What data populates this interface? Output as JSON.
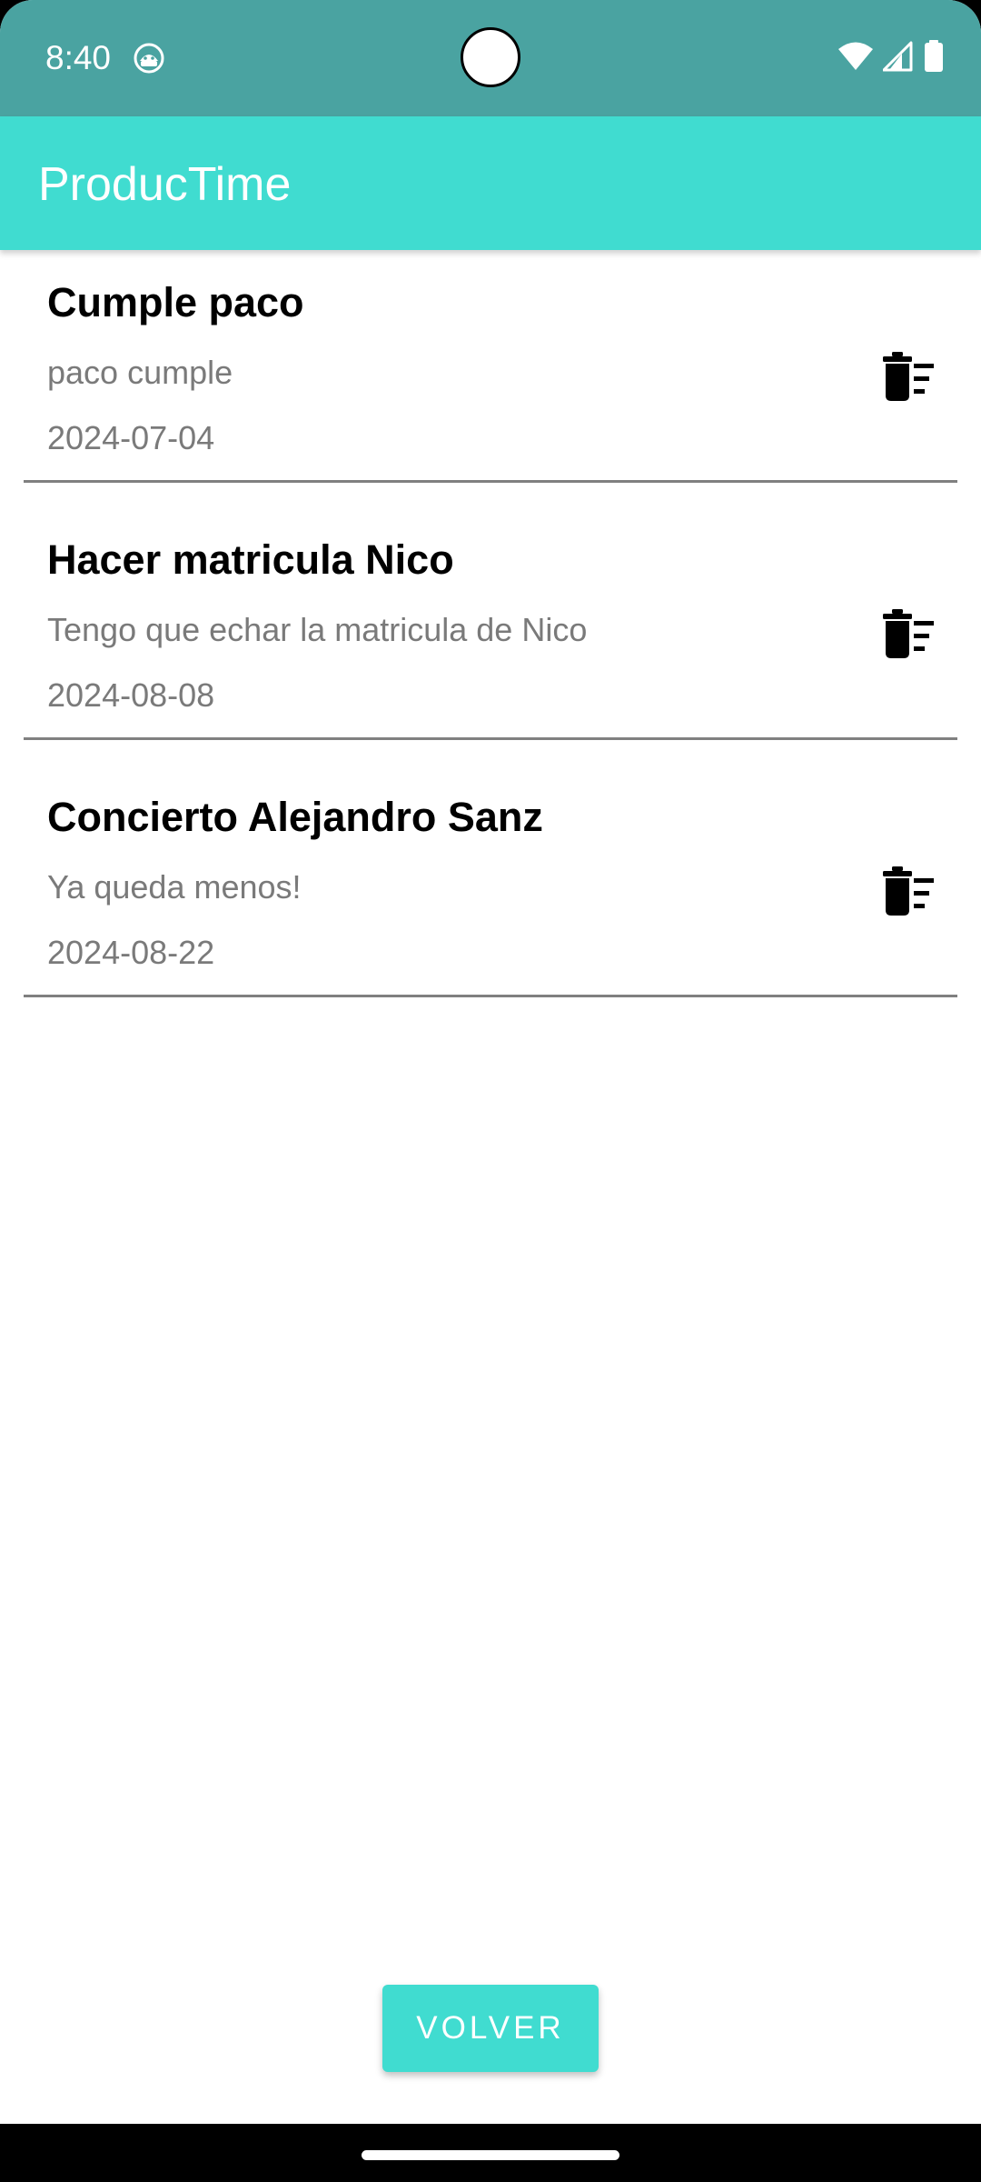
{
  "status_bar": {
    "time": "8:40",
    "app_icon": "android-robot-icon",
    "icons": [
      "wifi-icon",
      "cellular-signal-icon",
      "battery-icon"
    ]
  },
  "app_bar": {
    "title": "ProducTime"
  },
  "tasks": [
    {
      "title": "Cumple paco",
      "description": "paco cumple",
      "date": "2024-07-04",
      "action_icon": "delete-sweep-icon"
    },
    {
      "title": "Hacer matricula Nico",
      "description": "Tengo que echar la matricula de Nico",
      "date": "2024-08-08",
      "action_icon": "delete-sweep-icon"
    },
    {
      "title": "Concierto Alejandro Sanz",
      "description": "Ya queda menos!",
      "date": "2024-08-22",
      "action_icon": "delete-sweep-icon"
    }
  ],
  "footer": {
    "back_button_label": "VOLVER"
  },
  "colors": {
    "status_bar": "#4aa3a1",
    "accent": "#40dcd0",
    "secondary_text": "#7a7a7a",
    "divider": "#808080"
  }
}
